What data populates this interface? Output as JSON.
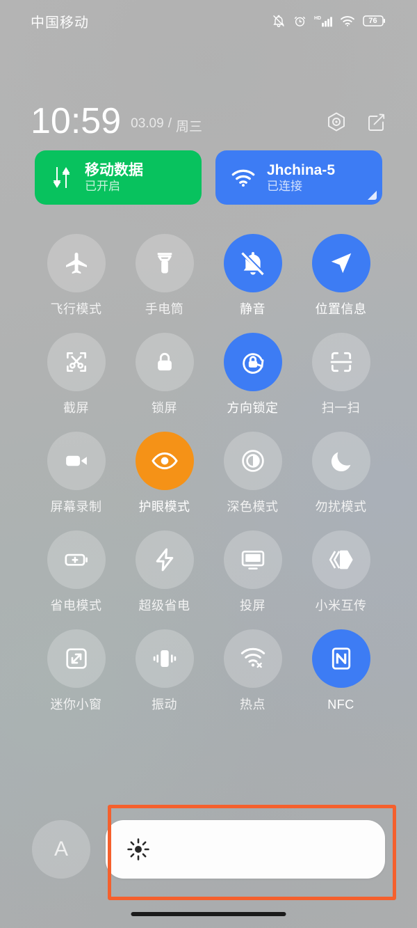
{
  "status_bar": {
    "carrier": "中国移动",
    "battery_level": "76",
    "icons": [
      "bell-muted-icon",
      "alarm-clock-icon",
      "hd-signal-icon",
      "wifi-icon",
      "battery-icon"
    ]
  },
  "clock": {
    "time": "10:59",
    "date": "03.09",
    "separator": "/",
    "weekday": "周三",
    "settings_icon": "gear-icon",
    "edit_icon": "edit-icon"
  },
  "connection_cards": [
    {
      "name": "mobile-data",
      "title": "移动数据",
      "status": "已开启",
      "color": "#08c25e",
      "icon": "data-transfer-icon",
      "has_corner": false
    },
    {
      "name": "wifi",
      "title": "Jhchina-5",
      "status": "已连接",
      "color": "#3d7cf4",
      "icon": "wifi-icon",
      "has_corner": true
    }
  ],
  "tiles": [
    {
      "label": "飞行模式",
      "icon": "airplane-icon",
      "state": "off"
    },
    {
      "label": "手电筒",
      "icon": "flashlight-icon",
      "state": "off"
    },
    {
      "label": "静音",
      "icon": "bell-muted-icon",
      "state": "on-blue"
    },
    {
      "label": "位置信息",
      "icon": "location-arrow-icon",
      "state": "on-blue"
    },
    {
      "label": "截屏",
      "icon": "screenshot-icon",
      "state": "off"
    },
    {
      "label": "锁屏",
      "icon": "lock-icon",
      "state": "off"
    },
    {
      "label": "方向锁定",
      "icon": "rotation-lock-icon",
      "state": "on-blue"
    },
    {
      "label": "扫一扫",
      "icon": "scan-icon",
      "state": "off"
    },
    {
      "label": "屏幕录制",
      "icon": "video-camera-icon",
      "state": "off"
    },
    {
      "label": "护眼模式",
      "icon": "eye-icon",
      "state": "on-orange"
    },
    {
      "label": "深色模式",
      "icon": "contrast-icon",
      "state": "off"
    },
    {
      "label": "勿扰模式",
      "icon": "moon-icon",
      "state": "off"
    },
    {
      "label": "省电模式",
      "icon": "battery-saver-icon",
      "state": "off"
    },
    {
      "label": "超级省电",
      "icon": "lightning-icon",
      "state": "off"
    },
    {
      "label": "投屏",
      "icon": "cast-screen-icon",
      "state": "off"
    },
    {
      "label": "小米互传",
      "icon": "mi-share-icon",
      "state": "off"
    },
    {
      "label": "迷你小窗",
      "icon": "mini-window-icon",
      "state": "off"
    },
    {
      "label": "振动",
      "icon": "vibrate-icon",
      "state": "off"
    },
    {
      "label": "热点",
      "icon": "hotspot-icon",
      "state": "off"
    },
    {
      "label": "NFC",
      "icon": "nfc-icon",
      "state": "on-blue"
    }
  ],
  "brightness": {
    "auto_label": "A",
    "slider_icon": "sun-icon",
    "fill_percent": 100
  },
  "annotation": {
    "color": "#f5602d",
    "target": "brightness-slider"
  },
  "colors": {
    "accent_blue": "#3d7cf4",
    "accent_orange": "#f59217",
    "accent_green": "#08c25e",
    "annotation_orange": "#f5602d"
  }
}
